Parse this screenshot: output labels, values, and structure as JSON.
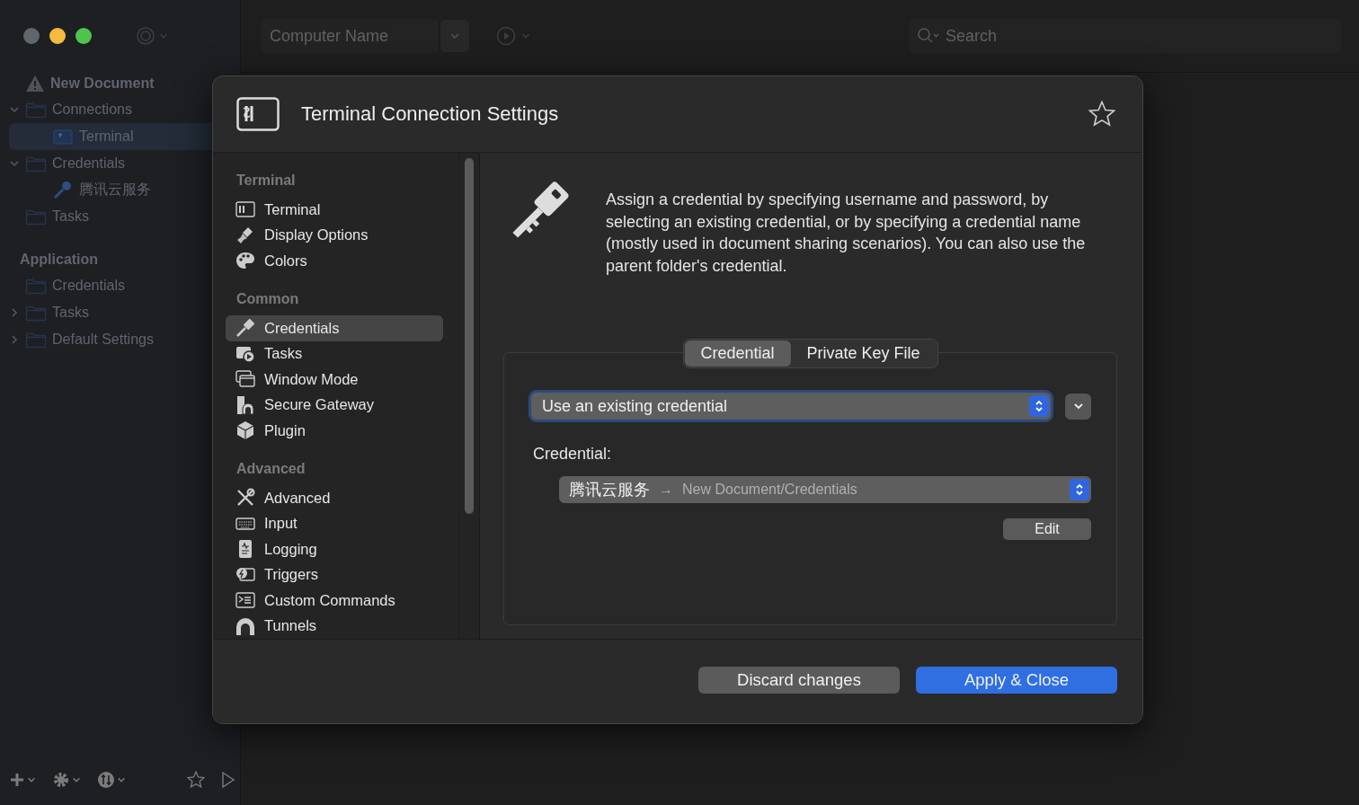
{
  "toolbar": {
    "computer_name": {
      "placeholder": "Computer Name"
    },
    "search": {
      "placeholder": "Search"
    }
  },
  "sidebar": {
    "tree": [
      {
        "label": "New Document",
        "kind": "document",
        "selected": false,
        "children": [
          {
            "label": "Connections",
            "kind": "folder",
            "selected": false,
            "expanded": true,
            "children": [
              {
                "label": "Terminal",
                "kind": "terminal",
                "selected": true
              }
            ]
          },
          {
            "label": "Credentials",
            "kind": "folder",
            "selected": false,
            "expanded": true,
            "children": [
              {
                "label": "腾讯云服务",
                "kind": "credential",
                "selected": false
              }
            ]
          },
          {
            "label": "Tasks",
            "kind": "folder",
            "selected": false
          }
        ]
      }
    ],
    "application": {
      "title": "Application",
      "items": [
        {
          "label": "Credentials",
          "kind": "folder",
          "selected": false
        },
        {
          "label": "Tasks",
          "kind": "folder",
          "selected": false,
          "expanded": false
        },
        {
          "label": "Default Settings",
          "kind": "folder",
          "selected": false,
          "expanded": false
        }
      ]
    }
  },
  "dialog": {
    "title": "Terminal Connection Settings",
    "favorite": false,
    "groups": [
      {
        "title": "Terminal",
        "items": [
          {
            "label": "Terminal",
            "selected": false
          },
          {
            "label": "Display Options",
            "selected": false
          },
          {
            "label": "Colors",
            "selected": false
          }
        ]
      },
      {
        "title": "Common",
        "items": [
          {
            "label": "Credentials",
            "selected": true
          },
          {
            "label": "Tasks",
            "selected": false
          },
          {
            "label": "Window Mode",
            "selected": false
          },
          {
            "label": "Secure Gateway",
            "selected": false
          },
          {
            "label": "Plugin",
            "selected": false
          }
        ]
      },
      {
        "title": "Advanced",
        "items": [
          {
            "label": "Advanced",
            "selected": false
          },
          {
            "label": "Input",
            "selected": false
          },
          {
            "label": "Logging",
            "selected": false
          },
          {
            "label": "Triggers",
            "selected": false
          },
          {
            "label": "Custom Commands",
            "selected": false
          },
          {
            "label": "Tunnels",
            "selected": false
          }
        ]
      }
    ],
    "description": "Assign a credential by specifying username and password, by selecting an existing credential, or by specifying a credential name (mostly used in document sharing scenarios). You can also use the parent folder's credential.",
    "tabs": [
      {
        "label": "Credential",
        "selected": true
      },
      {
        "label": "Private Key File",
        "selected": false
      }
    ],
    "mode": {
      "value": "Use an existing credential"
    },
    "credential": {
      "label": "Credential:",
      "name": "腾讯云服务",
      "arrow": "→",
      "path": "New Document/Credentials"
    },
    "edit_button": "Edit",
    "buttons": [
      {
        "label": "Discard changes",
        "kind": "secondary"
      },
      {
        "label": "Apply & Close",
        "kind": "primary"
      }
    ]
  }
}
